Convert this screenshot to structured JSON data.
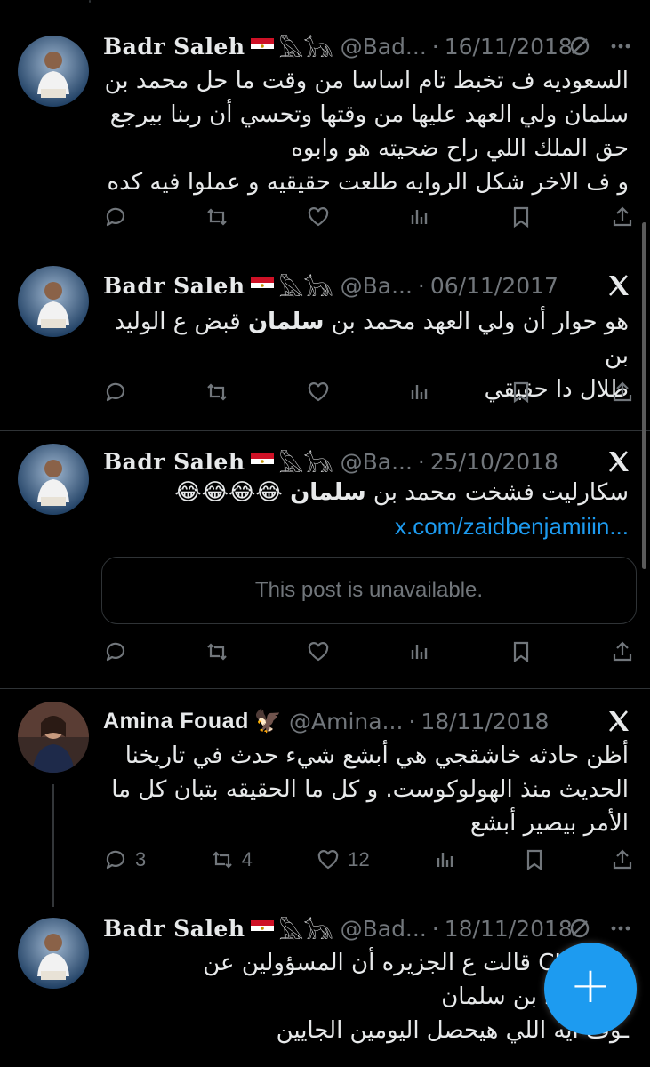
{
  "posts": [
    {
      "name": "Badr Saleh",
      "glyphs": "𓅓𓃥",
      "handle": "@Bad...",
      "date": "16/11/2018",
      "lines": [
        "السعوديه ف تخبط تام اساسا من وقت ما حل محمد بن",
        "سلمان ولي العهد عليها من وقتها وتحسي أن ربنا بيرجع",
        "حق الملك اللي راح ضحيته هو وابوه",
        "و ف الاخر شكل الروايه طلعت حقيقيه و عملوا فيه كده"
      ],
      "icon": "slash-circle-icon"
    },
    {
      "name": "Badr Saleh",
      "glyphs": "𓅓𓃥",
      "handle": "@Ba...",
      "date": "06/11/2017",
      "line1_pre": "هو حوار أن ولي العهد محمد بن ",
      "line1_bold": "سلمان",
      "line1_post": " قبض ع الوليد بن",
      "line2": "طلال دا حقيقي",
      "icon": "x-logo-icon"
    },
    {
      "name": "Badr Saleh",
      "glyphs": "𓅓𓃥",
      "handle": "@Ba...",
      "date": "25/10/2018",
      "line1_pre": "سكارليت فشخت محمد بن ",
      "line1_bold": "سلمان",
      "emojis": "😂😂😂😂",
      "link": "x.com/zaidbenjamiiin...",
      "unavailable": "This post is unavailable.",
      "icon": "x-logo-icon"
    },
    {
      "name": "Amina Fouad",
      "glyphs": "🦅",
      "handle": "@Amina...",
      "date": "18/11/2018",
      "lines": [
        "أظن حادثه خاشقجي هي أبشع شيء حدث في تاريخنا",
        "الحديث منذ الهولوكوست. و كل ما الحقيقه بتبان كل ما",
        "الأمر بيصير أبشع"
      ],
      "replies": "3",
      "reposts": "4",
      "likes": "12",
      "icon": "x-logo-icon"
    },
    {
      "name": "Badr Saleh",
      "glyphs": "𓅓𓃥",
      "handle": "@Bad...",
      "date": "18/11/2018",
      "lines": [
        "ـا ال CIA قالت ع الجزيره أن المسؤولين عن",
        "هو محمد بن سلمان",
        "ـوف ايه اللي هيحصل اليومين الجايين"
      ],
      "icon": "slash-circle-icon"
    }
  ],
  "compose_button": {
    "label": "+"
  },
  "colors": {
    "accent": "#1d9bf0",
    "muted": "#71767b",
    "border": "#2f3336"
  }
}
